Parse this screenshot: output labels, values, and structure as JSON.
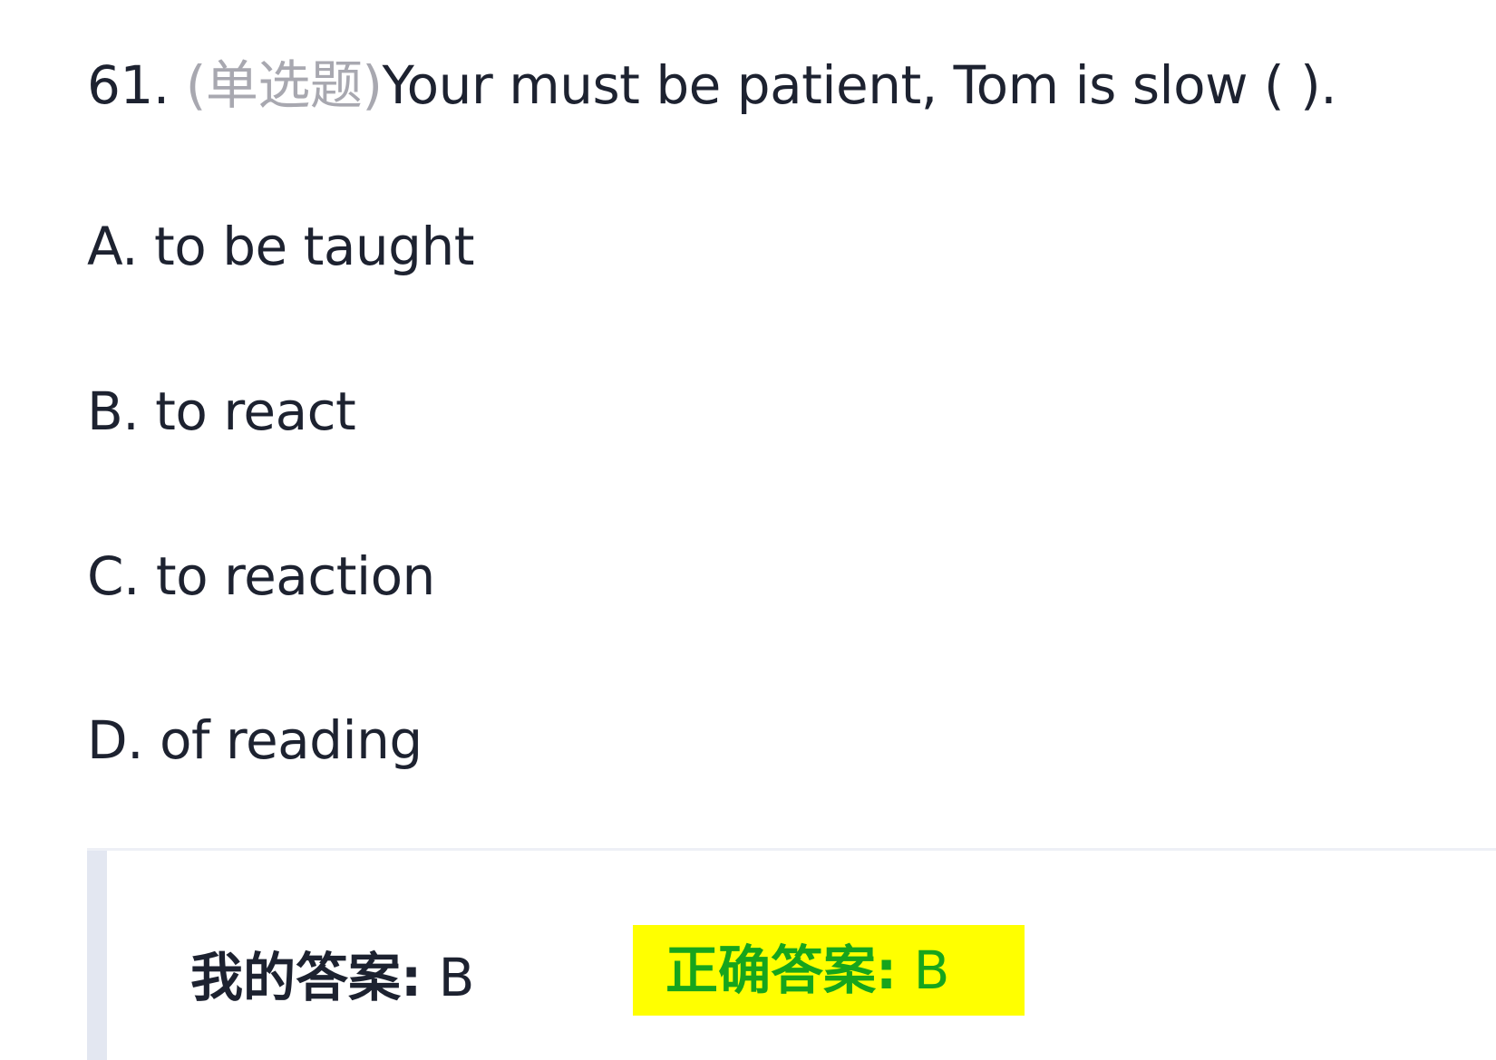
{
  "question": {
    "number": "61.",
    "type_label": "(单选题)",
    "text": "Your must be patient, Tom is slow ( )."
  },
  "options": [
    {
      "label": "A. to be taught"
    },
    {
      "label": "B. to react"
    },
    {
      "label": "C. to reaction"
    },
    {
      "label": "D. of reading"
    }
  ],
  "answers": {
    "my_answer_label": "我的答案:",
    "my_answer_value": "B",
    "correct_answer_label": "正确答案:",
    "correct_answer_value": "B"
  },
  "colors": {
    "highlight": "#ffff00",
    "correct_text": "#16a51c",
    "type_label": "#a8a8b0"
  }
}
